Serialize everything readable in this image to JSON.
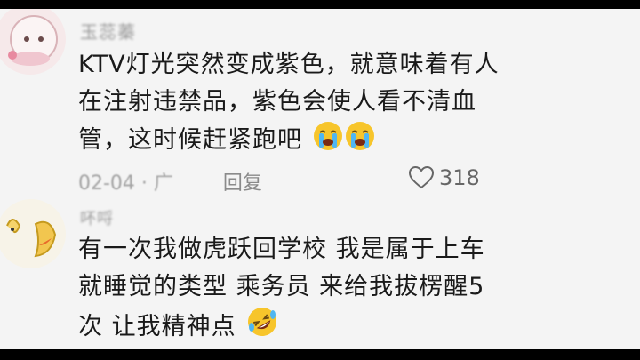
{
  "comments": [
    {
      "username": "玉蕊蓁",
      "lines": [
        "KTV灯光突然变成紫色，就意味着有人",
        "在注射违禁品，紫色会使人看不清血",
        "管，这时候赶紧跑吧"
      ],
      "emoji": [
        "loudly-crying-face",
        "loudly-crying-face"
      ],
      "date": "02-04 · 广",
      "reply_label": "回复",
      "likes": "318"
    },
    {
      "username": "吥哷",
      "lines": [
        "有一次我做虎跃回学校  我是属于上车",
        "就睡觉的类型  乘务员  来给我拔楞醒5",
        "次  让我精神点"
      ],
      "emoji": [
        "rolling-on-floor-laughing-face"
      ]
    }
  ],
  "colors": {
    "background": "#f4f4f4",
    "text": "#1a1a1a",
    "meta": "#a3a3a3"
  }
}
